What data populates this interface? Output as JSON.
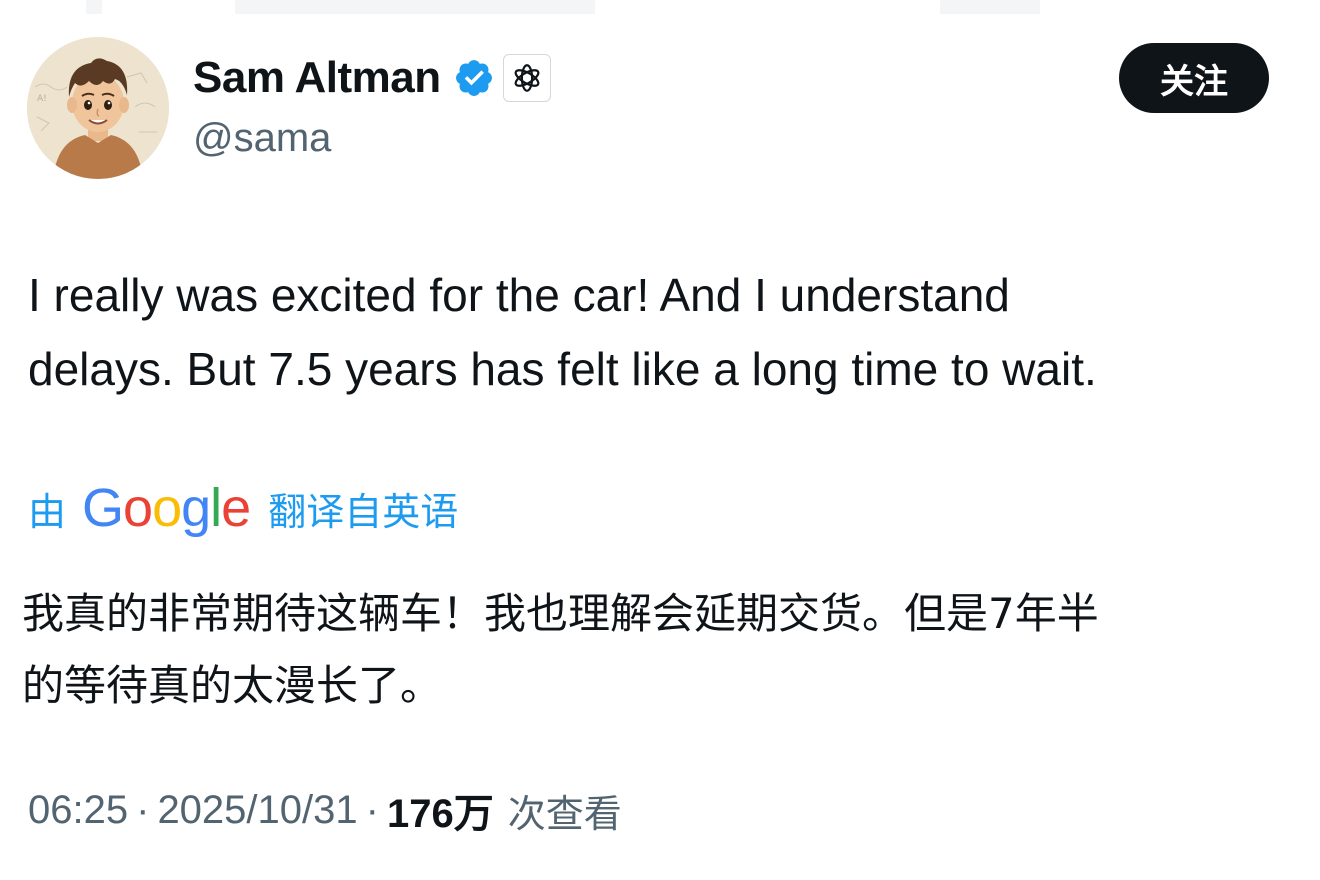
{
  "author": {
    "display_name": "Sam Altman",
    "handle": "@sama",
    "verified_color": "#1d9bf0"
  },
  "follow_button": {
    "label": "关注"
  },
  "tweet": {
    "text_lines": [
      "I really was excited for the car! And I understand",
      "delays. But 7.5 years has felt like a long time to wait."
    ]
  },
  "translation": {
    "prefix": "由",
    "provider": "Google",
    "suffix": "翻译自英语",
    "text_lines": [
      "我真的非常期待这辆车！我也理解会延期交货。但是7年半",
      "的等待真的太漫长了。"
    ]
  },
  "meta": {
    "time": "06:25",
    "separator": "·",
    "date": "2025/10/31",
    "views_count": "176万",
    "views_label": "次查看"
  },
  "colors": {
    "accent": "#1d9bf0",
    "text": "#0f1419",
    "muted": "#536471",
    "google_blue": "#4285f4",
    "google_red": "#ea4335",
    "google_yellow": "#fbbc05",
    "google_green": "#34a853"
  },
  "icons": {
    "verified": "verified-badge-icon",
    "affiliate": "openai-logo-icon"
  }
}
